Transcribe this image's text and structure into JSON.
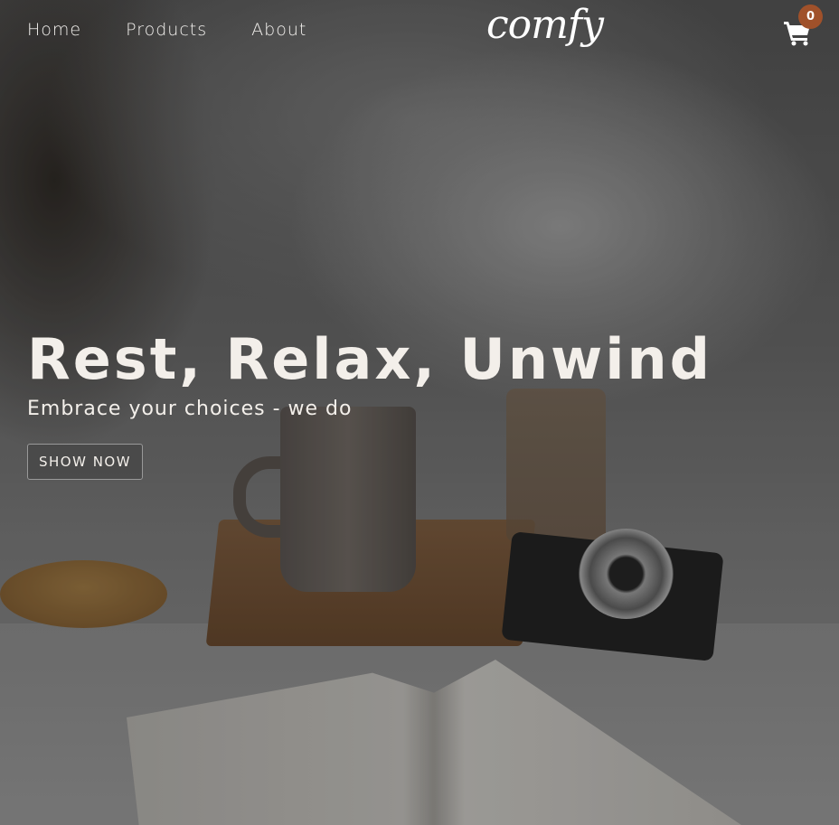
{
  "nav": {
    "links": [
      "Home",
      "Products",
      "About"
    ],
    "logo": "comfy",
    "cart_count": "0"
  },
  "hero": {
    "title": "Rest, Relax, Unwind",
    "subtitle": "Embrace your choices - we do",
    "button": "SHOW NOW"
  },
  "colors": {
    "badge": "#a0512a",
    "text": "#f3efea"
  }
}
